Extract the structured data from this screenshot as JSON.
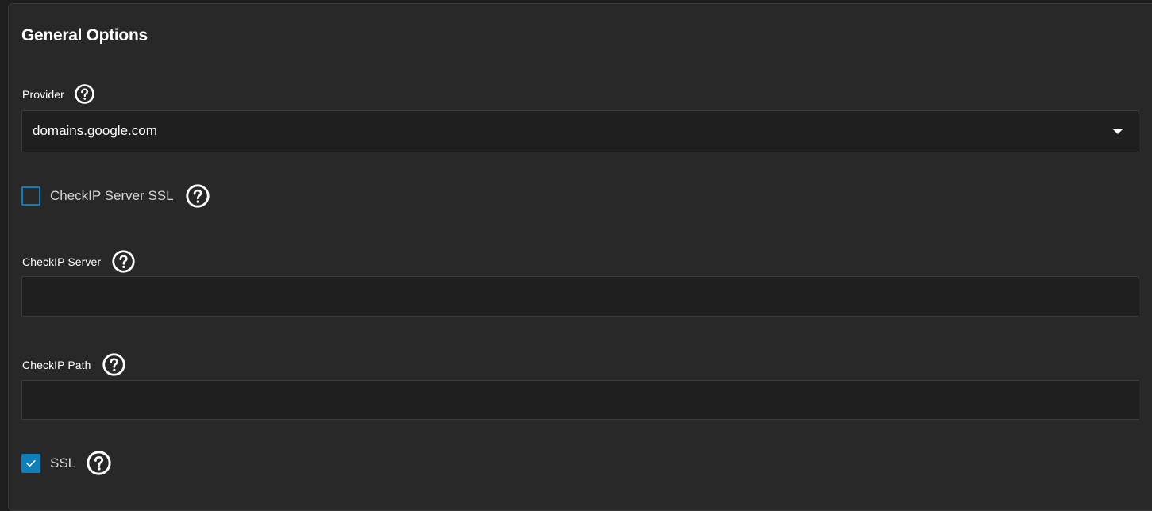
{
  "section": {
    "title": "General Options"
  },
  "provider": {
    "label": "Provider",
    "value": "domains.google.com",
    "help_icon": "help-circle-icon",
    "caret_icon": "caret-down-icon"
  },
  "checkip_server_ssl": {
    "label": "CheckIP Server SSL",
    "checked": false,
    "help_icon": "help-circle-icon"
  },
  "checkip_server": {
    "label": "CheckIP Server",
    "value": "",
    "help_icon": "help-circle-icon"
  },
  "checkip_path": {
    "label": "CheckIP Path",
    "value": "",
    "help_icon": "help-circle-icon"
  },
  "ssl": {
    "label": "SSL",
    "checked": true,
    "help_icon": "help-circle-icon",
    "check_icon": "checkmark-icon"
  },
  "colors": {
    "background": "#1e1e1e",
    "card": "#282828",
    "input_background": "#1f1f1f",
    "accent": "#0e7fb8",
    "text": "#ffffff"
  }
}
